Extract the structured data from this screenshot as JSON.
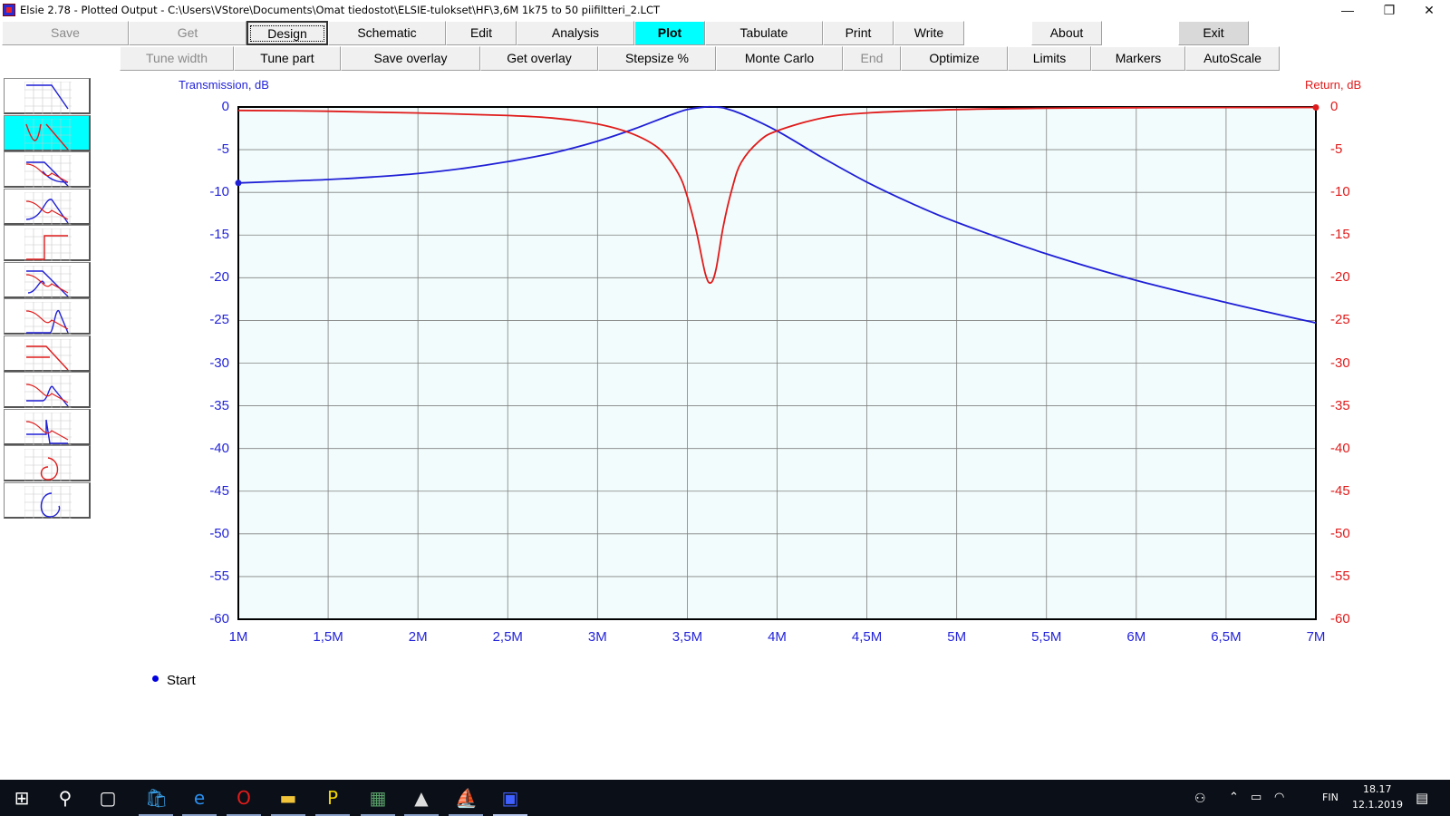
{
  "window": {
    "title": "Elsie 2.78 - Plotted Output - C:\\Users\\VStore\\Documents\\Omat tiedostot\\ELSIE-tulokset\\HF\\3,6M 1k75 to 50 piifiltteri_2.LCT",
    "minimize": "—",
    "restore": "❐",
    "close": "✕"
  },
  "toolbar1": [
    {
      "label": "Save",
      "state": "disabled"
    },
    {
      "label": "Get",
      "state": "disabled"
    },
    {
      "label": "Design",
      "state": "focused"
    },
    {
      "label": "Schematic",
      "state": "normal"
    },
    {
      "label": "Edit",
      "state": "normal"
    },
    {
      "label": "Analysis",
      "state": "normal"
    },
    {
      "label": "Plot",
      "state": "active"
    },
    {
      "label": "Tabulate",
      "state": "normal"
    },
    {
      "label": "Print",
      "state": "normal"
    },
    {
      "label": "Write",
      "state": "normal"
    },
    {
      "label": "About",
      "state": "normal"
    },
    {
      "label": "Exit",
      "state": "gray"
    }
  ],
  "toolbar2": [
    {
      "label": "Tune width",
      "state": "disabled"
    },
    {
      "label": "Tune part",
      "state": "normal"
    },
    {
      "label": "Save overlay",
      "state": "normal"
    },
    {
      "label": "Get overlay",
      "state": "normal"
    },
    {
      "label": "Stepsize %",
      "state": "normal"
    },
    {
      "label": "Monte Carlo",
      "state": "normal"
    },
    {
      "label": "End",
      "state": "disabled"
    },
    {
      "label": "Optimize",
      "state": "normal"
    },
    {
      "label": "Limits",
      "state": "normal"
    },
    {
      "label": "Markers",
      "state": "normal"
    },
    {
      "label": "AutoScale",
      "state": "normal"
    }
  ],
  "sidebar": {
    "selected_index": 1,
    "items": [
      "lowpass-transmission-icon",
      "transmission-return-icon",
      "return-loss-icon",
      "peak-response-icon",
      "step-response-icon",
      "phase-response-icon",
      "group-delay-icon",
      "delay-return-icon",
      "impulse-response-icon",
      "time-domain-icon",
      "smith-chart-spiral-icon",
      "smith-chart-icon"
    ]
  },
  "plot": {
    "left_axis_label": "Transmission, dB",
    "right_axis_label": "Return, dB",
    "y_ticks": [
      "0",
      "-5",
      "-10",
      "-15",
      "-20",
      "-25",
      "-30",
      "-35",
      "-40",
      "-45",
      "-50",
      "-55",
      "-60"
    ],
    "x_ticks": [
      "1M",
      "1,5M",
      "2M",
      "2,5M",
      "3M",
      "3,5M",
      "4M",
      "4,5M",
      "5M",
      "5,5M",
      "6M",
      "6,5M",
      "7M"
    ],
    "colors": {
      "transmission": "#1f1fd6",
      "return": "#e01b1b",
      "background": "#f2fcfc",
      "grid": "#808080"
    }
  },
  "chart_data": {
    "type": "line",
    "xlabel": "",
    "ylabel": "Transmission, dB",
    "y2label": "Return, dB",
    "xlim": [
      1,
      7
    ],
    "ylim": [
      -60,
      0
    ],
    "x_unit": "MHz",
    "grid": true,
    "series": [
      {
        "name": "Transmission, dB",
        "axis": "left",
        "color": "#1f1fd6",
        "x": [
          1.0,
          1.25,
          1.5,
          1.75,
          2.0,
          2.25,
          2.5,
          2.75,
          3.0,
          3.2,
          3.4,
          3.5,
          3.6,
          3.65,
          3.7,
          3.8,
          4.0,
          4.25,
          4.5,
          4.75,
          5.0,
          5.5,
          6.0,
          6.5,
          7.0
        ],
        "y": [
          -8.9,
          -8.7,
          -8.5,
          -8.2,
          -7.8,
          -7.2,
          -6.4,
          -5.4,
          -4.0,
          -2.6,
          -1.0,
          -0.3,
          0.0,
          0.0,
          -0.1,
          -0.8,
          -2.8,
          -5.9,
          -8.8,
          -11.3,
          -13.5,
          -17.2,
          -20.3,
          -22.9,
          -25.3
        ]
      },
      {
        "name": "Return, dB",
        "axis": "right",
        "color": "#e01b1b",
        "x": [
          1.0,
          1.5,
          2.0,
          2.5,
          2.75,
          3.0,
          3.2,
          3.35,
          3.45,
          3.5,
          3.55,
          3.6,
          3.63,
          3.66,
          3.7,
          3.75,
          3.8,
          3.9,
          4.0,
          4.25,
          4.5,
          5.0,
          5.5,
          6.0,
          7.0
        ],
        "y": [
          -0.4,
          -0.5,
          -0.7,
          -1.0,
          -1.3,
          -2.0,
          -3.2,
          -5.0,
          -7.8,
          -10.5,
          -14.5,
          -19.5,
          -20.6,
          -19.0,
          -14.0,
          -9.5,
          -6.5,
          -4.0,
          -2.8,
          -1.3,
          -0.7,
          -0.3,
          -0.15,
          -0.08,
          -0.05
        ]
      }
    ]
  },
  "legend": {
    "start_label": "Start"
  },
  "taskbar": {
    "icons": [
      "start-icon",
      "search-icon",
      "task-view-icon",
      "store-icon",
      "edge-icon",
      "opera-icon",
      "file-explorer-icon",
      "pdf-icon",
      "calculator-icon",
      "photos-icon",
      "app-icon",
      "elsie-icon"
    ],
    "language": "FIN",
    "time": "18.17",
    "date": "12.1.2019"
  }
}
